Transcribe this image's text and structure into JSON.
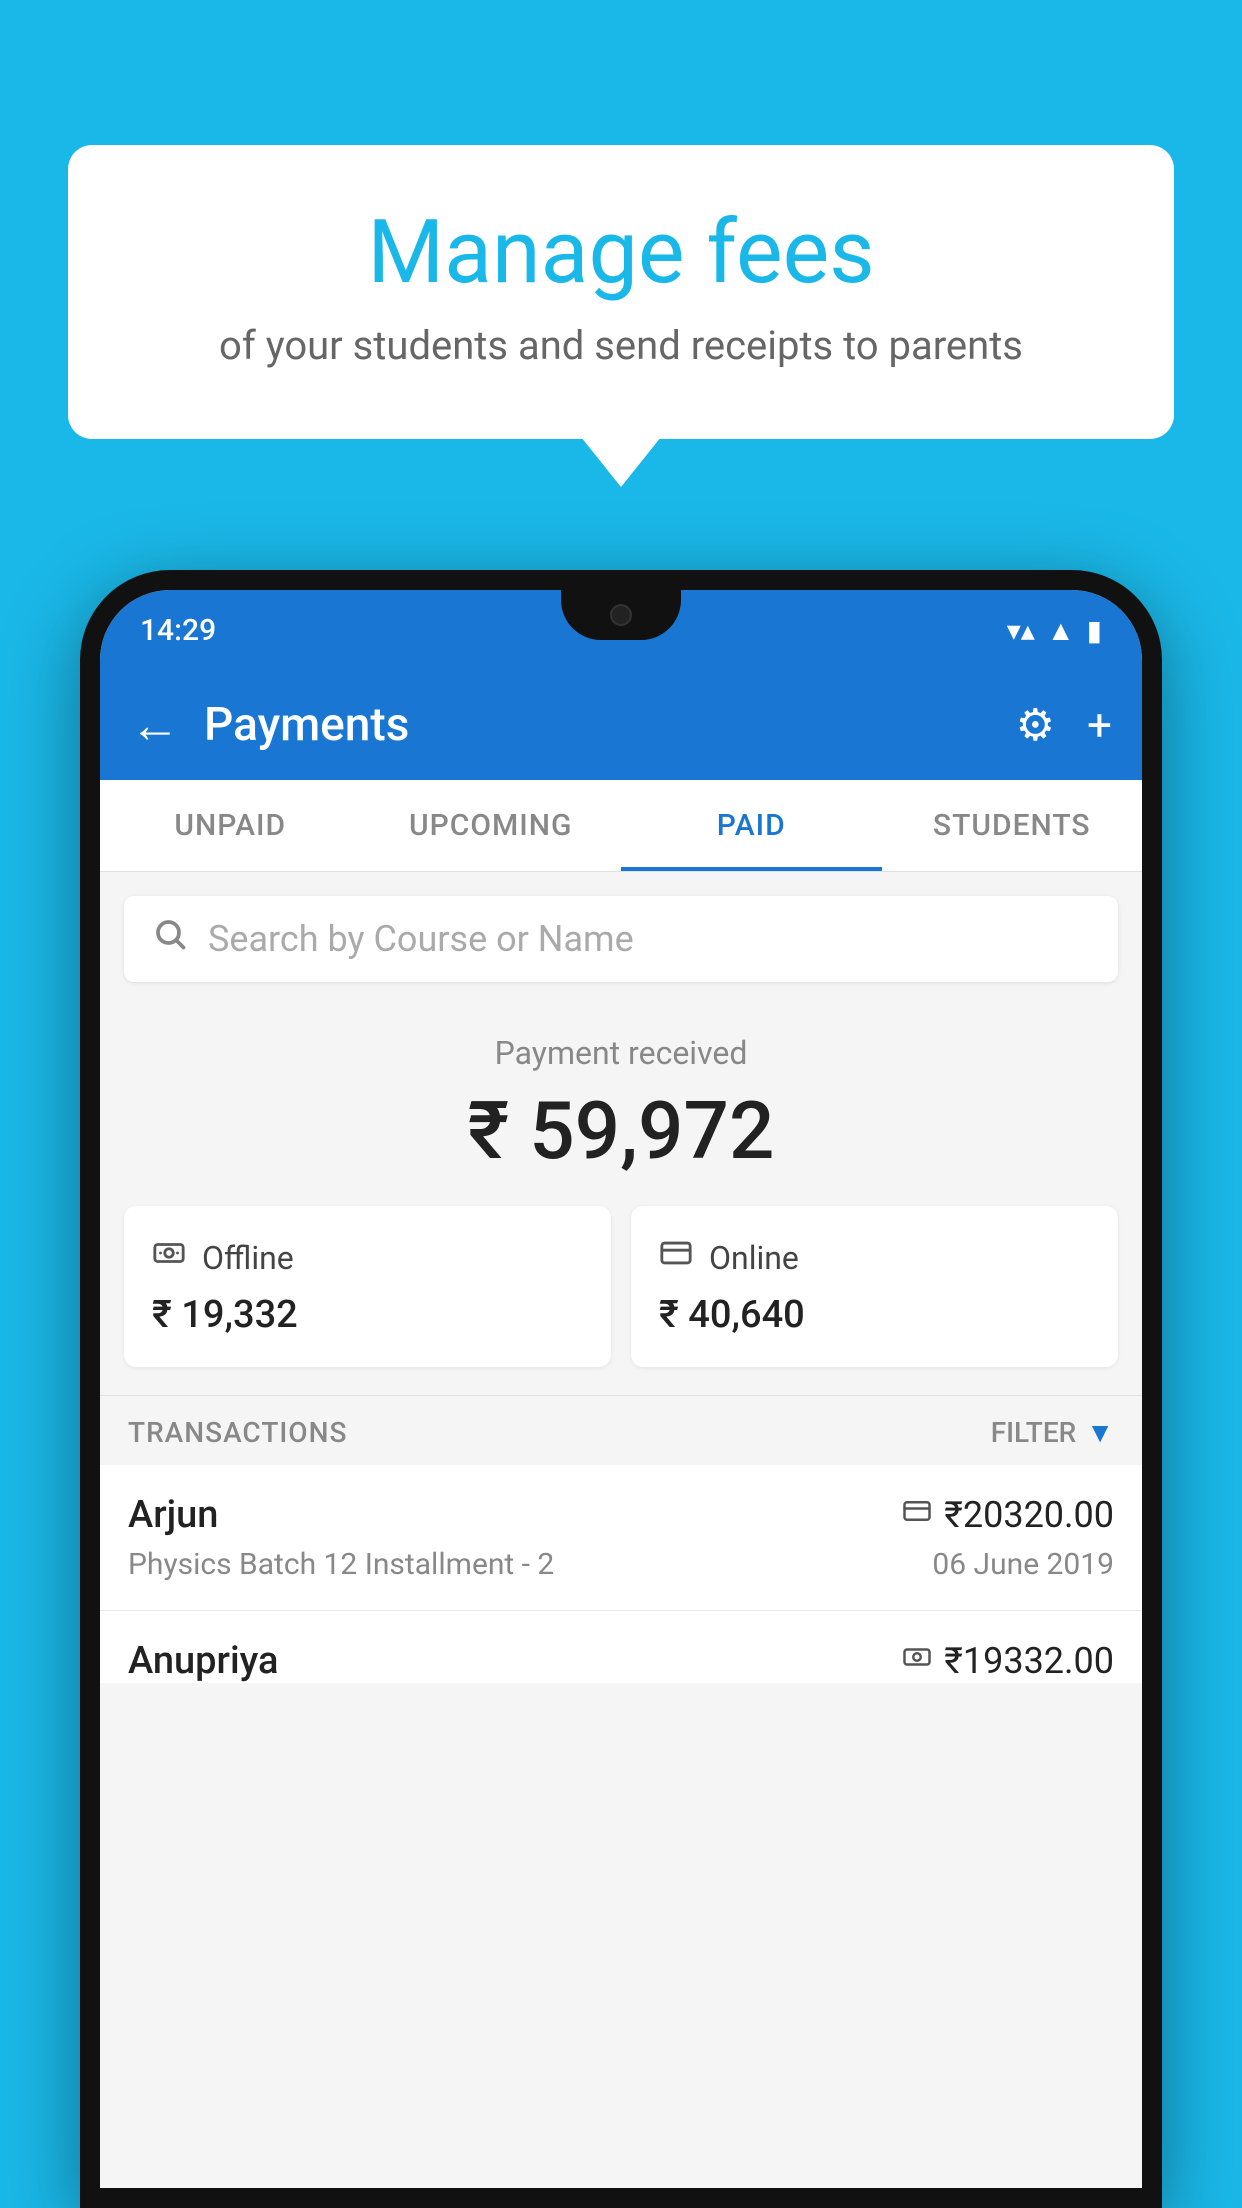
{
  "background_color": "#1ab8e8",
  "speech_bubble": {
    "title": "Manage fees",
    "subtitle": "of your students and send receipts to parents"
  },
  "phone": {
    "status_bar": {
      "time": "14:29",
      "wifi": "▼▲",
      "signal": "▲",
      "battery": "▮"
    },
    "app_bar": {
      "title": "Payments",
      "back_label": "←",
      "settings_label": "⚙",
      "add_label": "+"
    },
    "tabs": [
      {
        "label": "UNPAID",
        "active": false
      },
      {
        "label": "UPCOMING",
        "active": false
      },
      {
        "label": "PAID",
        "active": true
      },
      {
        "label": "STUDENTS",
        "active": false
      }
    ],
    "search": {
      "placeholder": "Search by Course or Name"
    },
    "payment_summary": {
      "label": "Payment received",
      "total": "₹ 59,972",
      "offline": {
        "label": "Offline",
        "amount": "₹ 19,332"
      },
      "online": {
        "label": "Online",
        "amount": "₹ 40,640"
      }
    },
    "transactions": {
      "section_label": "TRANSACTIONS",
      "filter_label": "FILTER",
      "items": [
        {
          "name": "Arjun",
          "amount": "₹20320.00",
          "payment_mode": "card",
          "course": "Physics Batch 12 Installment - 2",
          "date": "06 June 2019"
        },
        {
          "name": "Anupriya",
          "amount": "₹19332.00",
          "payment_mode": "cash",
          "course": "",
          "date": ""
        }
      ]
    }
  }
}
